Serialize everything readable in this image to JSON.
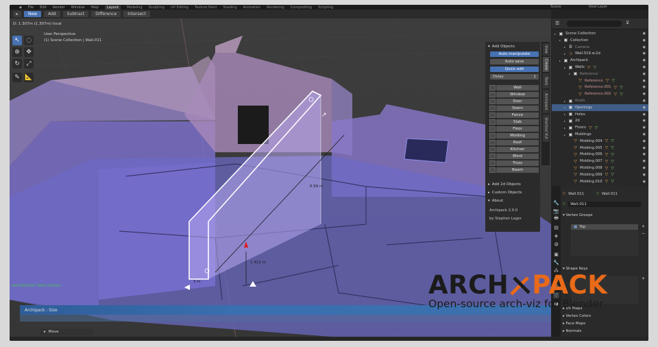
{
  "menubar": {
    "menus": [
      "File",
      "Edit",
      "Render",
      "Window",
      "Help"
    ],
    "workspaces": [
      "Layout",
      "Modeling",
      "Sculpting",
      "UV Editing",
      "Texture Paint",
      "Shading",
      "Animation",
      "Rendering",
      "Compositing",
      "Scripting"
    ],
    "active_workspace": "Layout",
    "scene": "Scene",
    "view_layer": "View Layer"
  },
  "tool_header": {
    "buttons": [
      "New",
      "Add",
      "Subtract",
      "Difference",
      "Intersect"
    ],
    "active": "New"
  },
  "viewport": {
    "delta_readout": "D: 1.307m (1.307m) local",
    "view_name": "User Perspective",
    "collection_path": "(1) Scene Collection | Wall.011",
    "dim_length": "6.99 m",
    "dim_height": "1.413 m",
    "dim_small": "3 m",
    "status_hint": "SHIFT:RESTRICT  SPACE:TOGGLE"
  },
  "npanel": {
    "add_objects_title": "Add Objects",
    "auto_manipulate": "Auto manipulate",
    "auto_save": "Auto save",
    "quick_edit": "Quick edit",
    "delay_label": "Delay",
    "delay_value": "1",
    "objects": [
      "Wall",
      "Window",
      "Door",
      "Stairs",
      "Fence",
      "Slab",
      "Floor",
      "Molding",
      "Roof",
      "Kitchen",
      "Blind",
      "Truss",
      "Beam"
    ],
    "add_2d_title": "Add 2d Objects",
    "custom_title": "Custom Objects",
    "about_title": "About",
    "about_version": "Archipack 2.0.0",
    "about_author": "by Stephen Leger"
  },
  "vtabs": [
    "View",
    "Create",
    "Tools",
    "Archipack",
    "Shortcut VUr"
  ],
  "operator": {
    "label": "Archipack : Size",
    "move_label": "Move"
  },
  "outliner": {
    "rows": [
      {
        "label": "Scene Collection",
        "icon": "collection-icon",
        "level": 0,
        "state": "normal"
      },
      {
        "label": "Collection",
        "icon": "collection-icon",
        "level": 1,
        "state": "normal"
      },
      {
        "label": "Camera",
        "icon": "camera-icon",
        "level": 2,
        "state": "dim"
      },
      {
        "label": "Wall.019.w.2d",
        "icon": "curve-icon",
        "level": 2,
        "state": "normal"
      },
      {
        "label": "Archipack",
        "icon": "collection-icon",
        "level": 1,
        "state": "normal"
      },
      {
        "label": "Walls",
        "icon": "collection-icon",
        "level": 2,
        "state": "normal"
      },
      {
        "label": "Reference",
        "icon": "collection-icon",
        "level": 3,
        "state": "dim"
      },
      {
        "label": "Reference",
        "icon": "mesh-icon",
        "level": 4,
        "state": "red"
      },
      {
        "label": "Reference.001",
        "icon": "mesh-icon",
        "level": 4,
        "state": "red"
      },
      {
        "label": "Reference.002",
        "icon": "mesh-icon",
        "level": 4,
        "state": "red"
      },
      {
        "label": "Roofs",
        "icon": "collection-icon",
        "level": 2,
        "state": "dim"
      },
      {
        "label": "Openings",
        "icon": "collection-icon",
        "level": 2,
        "state": "sel"
      },
      {
        "label": "Holes",
        "icon": "collection-icon",
        "level": 2,
        "state": "normal"
      },
      {
        "label": "2d",
        "icon": "collection-icon",
        "level": 2,
        "state": "normal"
      },
      {
        "label": "Floors",
        "icon": "collection-icon",
        "level": 2,
        "state": "normal"
      },
      {
        "label": "Moldings",
        "icon": "collection-icon",
        "level": 2,
        "state": "normal"
      },
      {
        "label": "Molding.004",
        "icon": "mesh-icon",
        "level": 3,
        "state": "normal"
      },
      {
        "label": "Molding.005",
        "icon": "mesh-icon",
        "level": 3,
        "state": "normal"
      },
      {
        "label": "Molding.006",
        "icon": "mesh-icon",
        "level": 3,
        "state": "normal"
      },
      {
        "label": "Molding.007",
        "icon": "mesh-icon",
        "level": 3,
        "state": "normal"
      },
      {
        "label": "Molding.008",
        "icon": "mesh-icon",
        "level": 3,
        "state": "normal"
      },
      {
        "label": "Molding.009",
        "icon": "mesh-icon",
        "level": 3,
        "state": "normal"
      },
      {
        "label": "Molding.010",
        "icon": "mesh-icon",
        "level": 3,
        "state": "normal"
      }
    ]
  },
  "properties": {
    "object_a": "Wall.011",
    "object_b": "Wall.011",
    "data_name": "Wall.011",
    "vertex_groups_title": "Vertex Groups",
    "vertex_group_item": "Top",
    "shape_keys_title": "Shape Keys",
    "uv_maps_title": "UV Maps",
    "vertex_colors_title": "Vertex Colors",
    "face_maps_title": "Face Maps",
    "normals_title": "Normals"
  },
  "logo": {
    "part1": "ARCH",
    "part2": "PACK",
    "tagline": "Open-source arch-viz for Blender"
  },
  "colors": {
    "accent_blue": "#4772b3",
    "logo_orange": "#e96a18",
    "logo_dark": "#1b1b1b",
    "wall_violet": "#7b70d8"
  }
}
